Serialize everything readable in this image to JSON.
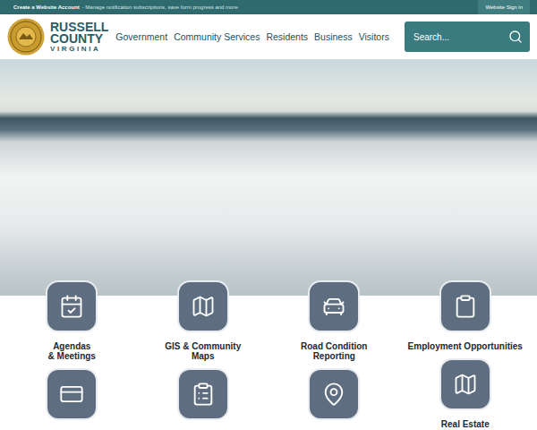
{
  "top_bar": {
    "account_link": "Create a Website Account",
    "account_note": "- Manage notification subscriptions, save form progress and more",
    "sign_in": "Website Sign in"
  },
  "logo": {
    "lines": [
      "RUSSELL",
      "COUNTY"
    ],
    "subtitle": "VIRGINIA"
  },
  "nav": {
    "items": [
      {
        "label": "Government"
      },
      {
        "label": "Community Services"
      },
      {
        "label": "Residents"
      },
      {
        "label": "Business"
      },
      {
        "label": "Visitors"
      }
    ]
  },
  "search": {
    "placeholder": "Search..."
  },
  "quick_links": [
    {
      "label_lines": [
        "Agendas",
        "& Meetings"
      ]
    },
    {
      "label_lines": [
        "GIS & Community",
        "Maps"
      ]
    },
    {
      "label_lines": [
        "Road Condition",
        "Reporting"
      ]
    },
    {
      "label_lines": [
        "Employment Opportunities"
      ]
    },
    {
      "label_lines": []
    },
    {
      "label_lines": []
    },
    {
      "label_lines": []
    },
    {
      "label_lines": [
        "Real Estate"
      ]
    }
  ]
}
